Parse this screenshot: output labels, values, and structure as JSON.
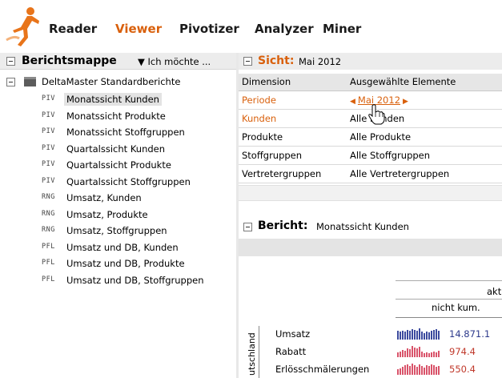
{
  "nav": {
    "items": [
      {
        "label": "Reader",
        "active": false
      },
      {
        "label": "Viewer",
        "active": true
      },
      {
        "label": "Pivotizer",
        "active": false
      },
      {
        "label": "Analyzer",
        "active": false
      },
      {
        "label": "Miner",
        "active": false
      }
    ],
    "accent_color": "#d9600c"
  },
  "left_panel": {
    "title": "Berichtsmappe",
    "menu_label": "▼ Ich möchte ...",
    "root": "DeltaMaster Standardberichte",
    "items": [
      {
        "type": "PIV",
        "label": "Monatssicht Kunden",
        "selected": true
      },
      {
        "type": "PIV",
        "label": "Monatssicht Produkte"
      },
      {
        "type": "PIV",
        "label": "Monatssicht Stoffgruppen"
      },
      {
        "type": "PIV",
        "label": "Quartalssicht Kunden"
      },
      {
        "type": "PIV",
        "label": "Quartalssicht Produkte"
      },
      {
        "type": "PIV",
        "label": "Quartalssicht Stoffgruppen"
      },
      {
        "type": "RNG",
        "label": "Umsatz, Kunden"
      },
      {
        "type": "RNG",
        "label": "Umsatz, Produkte"
      },
      {
        "type": "RNG",
        "label": "Umsatz, Stoffgruppen"
      },
      {
        "type": "PFL",
        "label": "Umsatz und DB, Kunden"
      },
      {
        "type": "PFL",
        "label": "Umsatz und DB, Produkte"
      },
      {
        "type": "PFL",
        "label": "Umsatz und DB, Stoffgruppen"
      }
    ]
  },
  "sicht": {
    "title": "Sicht:",
    "subtitle": "Mai 2012",
    "header": {
      "dimension": "Dimension",
      "elements": "Ausgewählte Elemente"
    },
    "periode": {
      "label": "Periode",
      "value": "Mai 2012"
    },
    "kunden": {
      "label": "Kunden",
      "value": "Alle Kunden"
    },
    "produkte": {
      "label": "Produkte",
      "value": "Alle Produkte"
    },
    "stoffgruppen": {
      "label": "Stoffgruppen",
      "value": "Alle Stoffgruppen"
    },
    "vertreter": {
      "label": "Vertretergruppen",
      "value": "Alle Vertretergruppen"
    }
  },
  "bericht": {
    "title": "Bericht:",
    "subtitle": "Monatssicht Kunden",
    "col_akt": "akt",
    "col_nichtkum": "nicht kum.",
    "group_label": "utschland",
    "rows": [
      {
        "label": "Umsatz",
        "value": "14.871.1",
        "kind": "pos"
      },
      {
        "label": "Rabatt",
        "value": "974.4",
        "kind": "neg"
      },
      {
        "label": "Erlösschmälerungen",
        "value": "550.4",
        "kind": "neg"
      }
    ]
  }
}
